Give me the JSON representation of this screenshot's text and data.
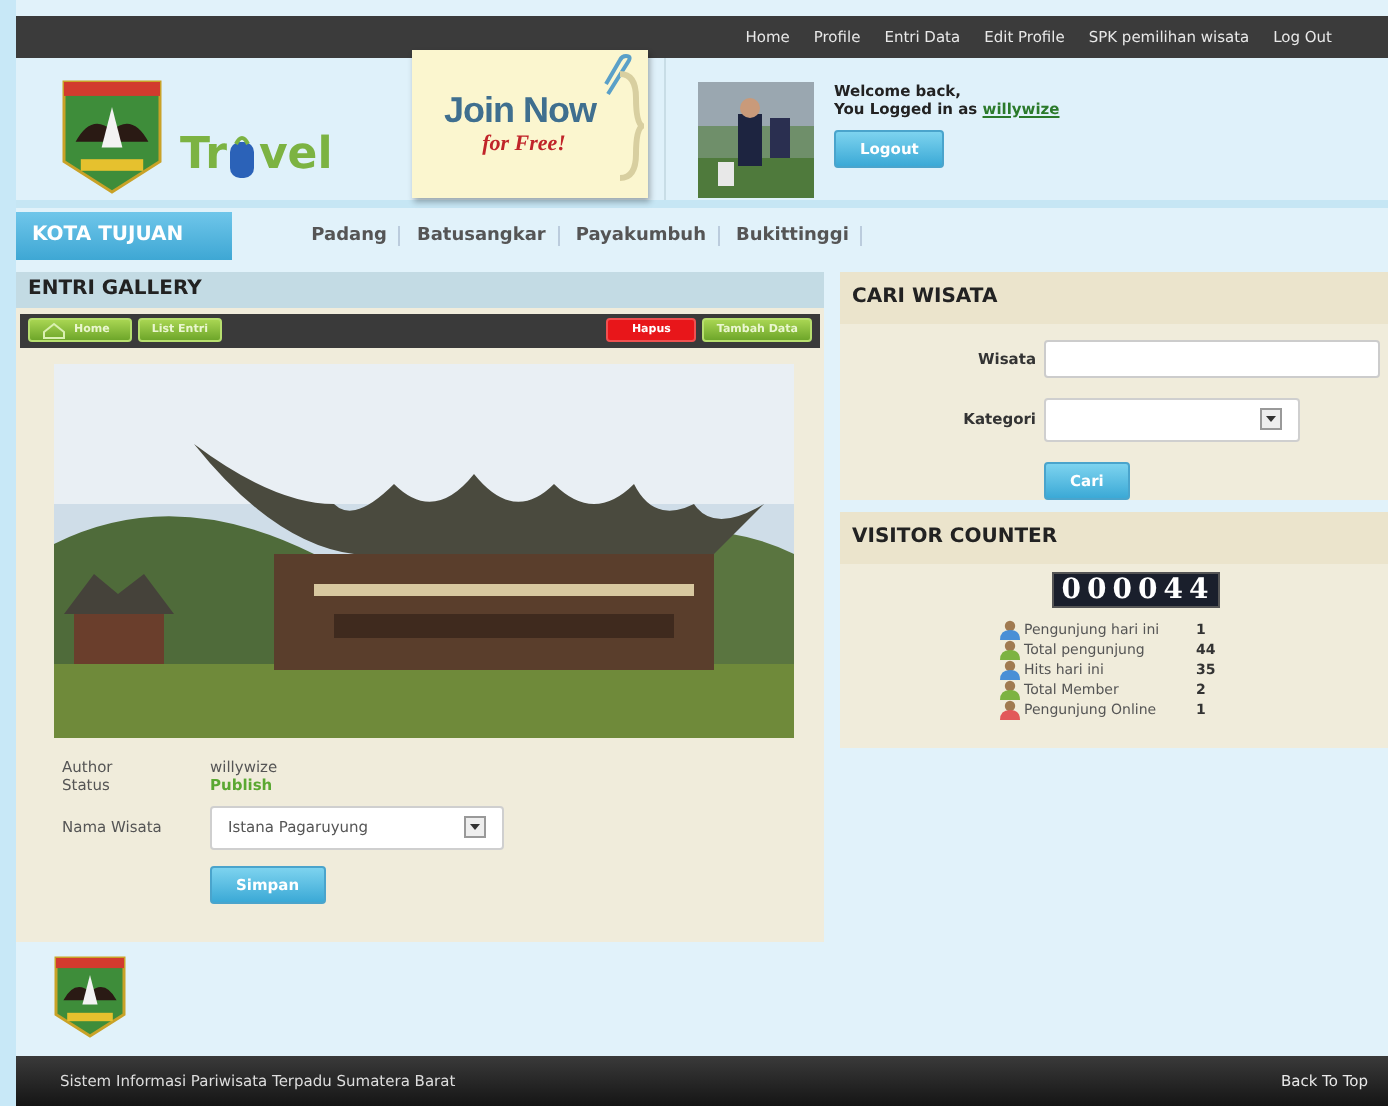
{
  "top_menu": [
    "Home",
    "Profile",
    "Entri Data",
    "Edit Profile",
    "SPK pemilihan wisata",
    "Log Out"
  ],
  "logo": {
    "text_start": "Tr",
    "text_end": "vel"
  },
  "promo": {
    "title": "Join Now",
    "subtitle": "for Free!"
  },
  "user": {
    "greeting": "Welcome back,",
    "logged_in": "You Logged in as",
    "username": "willywize",
    "logout": "Logout"
  },
  "nav": {
    "title": "KOTA TUJUAN",
    "items": [
      "Padang",
      "Batusangkar",
      "Payakumbuh",
      "Bukittinggi"
    ]
  },
  "gallery": {
    "title": "ENTRI GALLERY",
    "toolbar": [
      {
        "label": "Home",
        "kind": "home"
      },
      {
        "label": "List Entri",
        "kind": "plain"
      },
      {
        "label": "Hapus",
        "kind": "danger"
      },
      {
        "label": "Tambah Data",
        "kind": "plain"
      }
    ],
    "author_label": "Author",
    "author": "willywize",
    "status_label": "Status",
    "status": "Publish",
    "name_label": "Nama Wisata",
    "name_value": "Istana Pagaruyung",
    "save": "Simpan"
  },
  "search": {
    "title": "CARI WISATA",
    "wisata_label": "Wisata",
    "kategori_label": "Kategori",
    "button": "Cari"
  },
  "visitors": {
    "title": "VISITOR COUNTER",
    "counter": "000044",
    "stats": [
      {
        "label": "Pengunjung hari ini",
        "value": "1",
        "color": "#4a8fd6"
      },
      {
        "label": "Total pengunjung",
        "value": "44",
        "color": "#7cb342"
      },
      {
        "label": "Hits hari ini",
        "value": "35",
        "color": "#4a8fd6"
      },
      {
        "label": "Total Member",
        "value": "2",
        "color": "#7cb342"
      },
      {
        "label": "Pengunjung Online",
        "value": "1",
        "color": "#e2585a"
      }
    ]
  },
  "footer": {
    "text": "Sistem Informasi Pariwisata Terpadu Sumatera Barat",
    "back_to_top": "Back To Top"
  }
}
